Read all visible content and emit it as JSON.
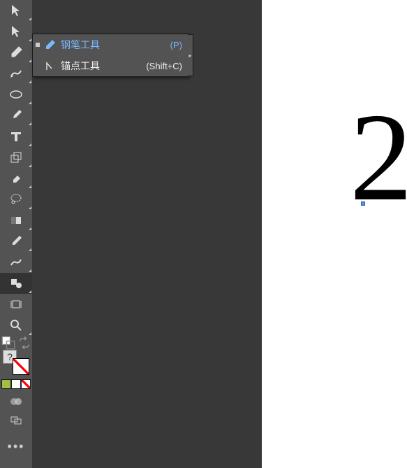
{
  "flyout": {
    "items": [
      {
        "label": "钢笔工具",
        "shortcut": "(P)",
        "active": true
      },
      {
        "label": "锚点工具",
        "shortcut": "(Shift+C)",
        "active": false
      }
    ]
  },
  "canvas": {
    "visible_text": "2"
  },
  "colors": {
    "toolbar_bg": "#535353",
    "panel_bg": "#383838",
    "active_text": "#7ab8ff",
    "mini_swatches": [
      "#a0c040",
      "#ffffff",
      "#ff0000"
    ]
  },
  "qmark": "?"
}
